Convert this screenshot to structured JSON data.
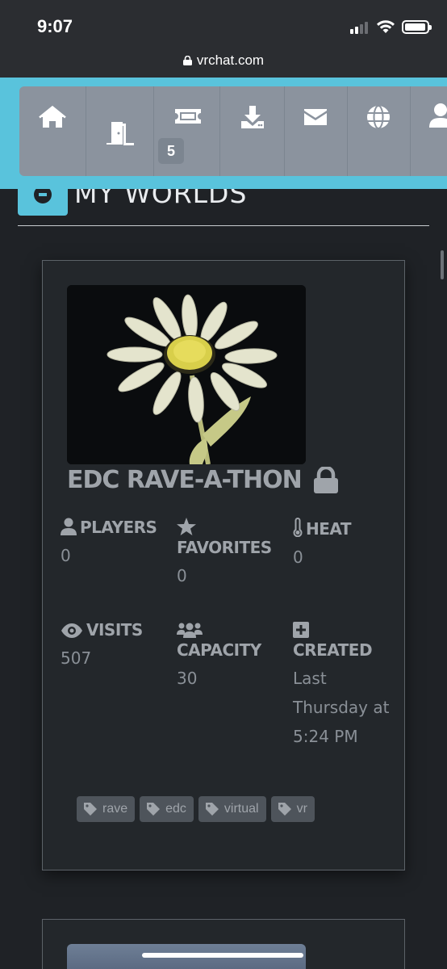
{
  "status_bar": {
    "time": "9:07"
  },
  "browser": {
    "url": "vrchat.com"
  },
  "nav": {
    "items": [
      {
        "icon": "home-icon"
      },
      {
        "icon": "door-icon"
      },
      {
        "icon": "ticket-icon",
        "badge": "5"
      },
      {
        "icon": "download-icon"
      },
      {
        "icon": "envelope-icon"
      },
      {
        "icon": "globe-icon"
      },
      {
        "icon": "user-icon"
      }
    ]
  },
  "section": {
    "title": "MY WORLDS"
  },
  "world": {
    "title": "EDC RAVE-A-THON",
    "stats": {
      "players": {
        "label": "PLAYERS",
        "value": "0"
      },
      "favorites": {
        "label": "FAVORITES",
        "value": "0"
      },
      "heat": {
        "label": "HEAT",
        "value": "0"
      },
      "visits": {
        "label": "VISITS",
        "value": "507"
      },
      "capacity": {
        "label": "CAPACITY",
        "value": "30"
      },
      "created": {
        "label": "CREATED",
        "value": "Last Thursday at 5:24 PM"
      }
    },
    "tags": [
      "rave",
      "edc",
      "virtual",
      "vr"
    ]
  },
  "colors": {
    "accent": "#59c3dc",
    "nav_panel": "#8b939e",
    "background": "#1f2226"
  }
}
